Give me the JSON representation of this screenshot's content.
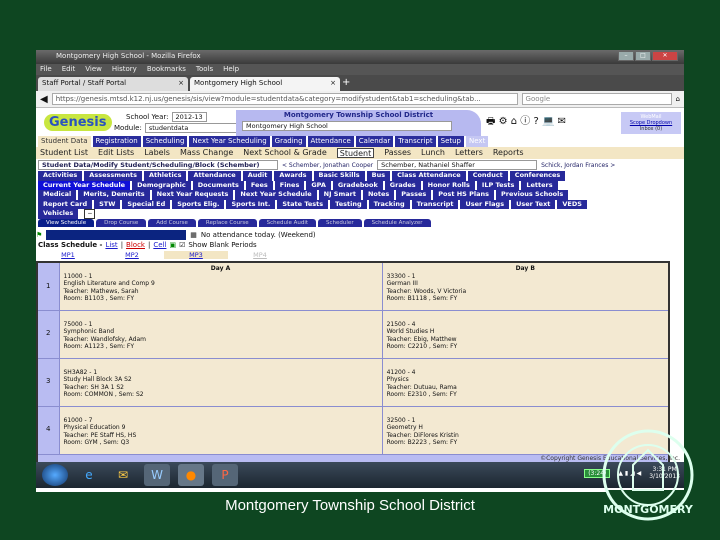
{
  "window": {
    "title": "Montgomery High School - Mozilla Firefox",
    "min": "–",
    "max": "□",
    "close": "✕"
  },
  "menu": [
    "File",
    "Edit",
    "View",
    "History",
    "Bookmarks",
    "Tools",
    "Help"
  ],
  "browser_tabs": [
    {
      "label": "Staff Portal / Staff Portal",
      "close": "×"
    },
    {
      "label": "Montgomery High School",
      "close": "×"
    }
  ],
  "new_tab": "+",
  "url": "https://genesis.mtsd.k12.nj.us/genesis/sis/view?module=studentdata&category=modifystudent&tab1=scheduling&tab...",
  "search_placeholder": "Google",
  "app": {
    "logo": "Genesis",
    "school_year_label": "School Year:",
    "school_year": "2012-13",
    "module_label": "Module:",
    "module": "studentdata",
    "district": "Montgomery Township School District",
    "school": "Montgomery High School",
    "web_mail": "WebMail",
    "scope_dropdown": "Scope Dropdown",
    "inbox": "Inbox (0)"
  },
  "top_tabs": [
    "Student Data",
    "Registration",
    "Scheduling",
    "Next Year Scheduling",
    "Grading",
    "Attendance",
    "Calendar",
    "Transcript",
    "Setup",
    "Next"
  ],
  "subnav": [
    "Student List",
    "Edit Lists",
    "Labels",
    "Mass Change",
    "Next School & Grade",
    "Student",
    "Passes",
    "Lunch",
    "Letters",
    "Reports"
  ],
  "breadcrumb_select": "Student Data/Modify Student/Scheduling/Block (Schember)",
  "prev_student": "< Schember, Jonathan Cooper",
  "current_student": "Schember, Nathaniel Shaffer",
  "next_student": "Schick, Jordan Frances >",
  "student_tabs": [
    [
      "Activities",
      "Assessments",
      "Athletics",
      "Attendance",
      "Audit",
      "Awards",
      "Basic Skills",
      "Bus",
      "Class Attendance",
      "Conduct",
      "Conferences"
    ],
    [
      "Current Year Schedule",
      "Demographic",
      "Documents",
      "Fees",
      "Fines",
      "GPA",
      "Gradebook",
      "Grades",
      "Honor Rolls",
      "ILP Tests",
      "Letters"
    ],
    [
      "Medical",
      "Merits, Demerits",
      "Next Year Requests",
      "Next Year Schedule",
      "NJ Smart",
      "Notes",
      "Passes",
      "Post HS Plans",
      "Previous Schools"
    ],
    [
      "Report Card",
      "STW",
      "Special Ed",
      "Sports Elig.",
      "Sports Int.",
      "State Tests",
      "Testing",
      "Tracking",
      "Transcript",
      "User Flags",
      "User Text",
      "VEDS"
    ],
    [
      "Vehicles"
    ]
  ],
  "collapse": "−",
  "action_tabs": [
    "View Schedule",
    "Drop Course",
    "Add Course",
    "Replace Course",
    "Schedule Audit",
    "Scheduler",
    "Schedule Analyzer"
  ],
  "attendance_note": "No attendance today. (Weekend)",
  "class_schedule": {
    "label": "Class Schedule -",
    "views": [
      "List",
      "Block",
      "Cell"
    ],
    "show_blank": "Show Blank Periods",
    "marking_periods": [
      "MP1",
      "MP2",
      "MP3",
      "MP4"
    ]
  },
  "schedule": {
    "days": [
      "Day A",
      "Day B"
    ],
    "periods": [
      {
        "num": "1",
        "a": [
          "11000 - 1",
          "English Literature and Comp 9",
          "Teacher: Mathews, Sarah",
          "Room: B1103 , Sem: FY"
        ],
        "b": [
          "33300 - 1",
          "German III",
          "Teacher: Woods, V Victoria",
          "Room: B1118 , Sem: FY"
        ]
      },
      {
        "num": "2",
        "a": [
          "75000 - 1",
          "Symphonic Band",
          "Teacher: Wandlofsky, Adam",
          "Room: A1123 , Sem: FY"
        ],
        "b": [
          "21500 - 4",
          "World Studies H",
          "Teacher: Ebig, Matthew",
          "Room: C2210 , Sem: FY"
        ]
      },
      {
        "num": "3",
        "a": [
          "SH3A82 - 1",
          "Study Hall Block 3A S2",
          "Teacher: SH 3A 1 S2",
          "Room: COMMON , Sem: S2"
        ],
        "b": [
          "41200 - 4",
          "Physics",
          "Teacher: Dutuau, Rama",
          "Room: E2310 , Sem: FY"
        ]
      },
      {
        "num": "4",
        "a": [
          "61000 - 7",
          "Physical Education 9",
          "Teacher: PE Staff HS, HS",
          "Room: GYM , Sem: Q3"
        ],
        "b": [
          "32500 - 1",
          "Geometry H",
          "Teacher: DiFlores Kristin",
          "Room: B2223 , Sem: FY"
        ]
      }
    ]
  },
  "copyright": "©Copyright Genesis Educational Services, Inc.",
  "taskbar": {
    "battery": "(3:24)",
    "time": "3:31 PM",
    "date": "3/10/2013"
  },
  "footer": "Montgomery Township School District",
  "seal_text": "MONTGOMERY"
}
